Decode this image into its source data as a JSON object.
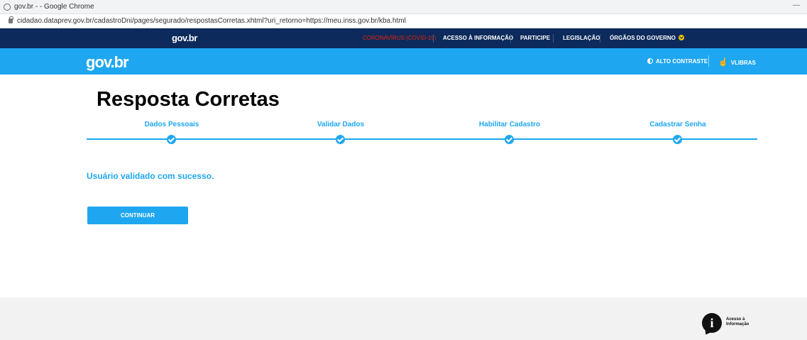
{
  "browser": {
    "title": "gov.br - - Google Chrome",
    "url": "cidadao.dataprev.gov.br/cadastroDni/pages/segurado/respostasCorretas.xhtml?uri_retorno=https://meu.inss.gov.br/kba.html"
  },
  "top_nav": {
    "logo": "gov.br",
    "items": [
      "CORONAVÍRUS (COVID-19)",
      "ACESSO À INFORMAÇÃO",
      "PARTICIPE",
      "LEGISLAÇÃO",
      "ÓRGÃOS DO GOVERNO"
    ],
    "alert_color": "#e52207"
  },
  "header": {
    "logo": "gov.br",
    "high_contrast": "ALTO CONTRASTE",
    "libras": "VLIBRAS"
  },
  "main": {
    "title": "Resposta Corretas",
    "steps": [
      "Dados Pessoais",
      "Validar Dados",
      "Habilitar Cadastro",
      "Cadastrar Senha"
    ],
    "success_message": "Usuário validado com sucesso.",
    "continue_label": "CONTINUAR"
  },
  "footer": {
    "access_info": "Acesso à Informação"
  },
  "colors": {
    "navy": "#0c2a5b",
    "brand_blue": "#1ea7f0",
    "footer_bg": "#f2f2f2"
  }
}
